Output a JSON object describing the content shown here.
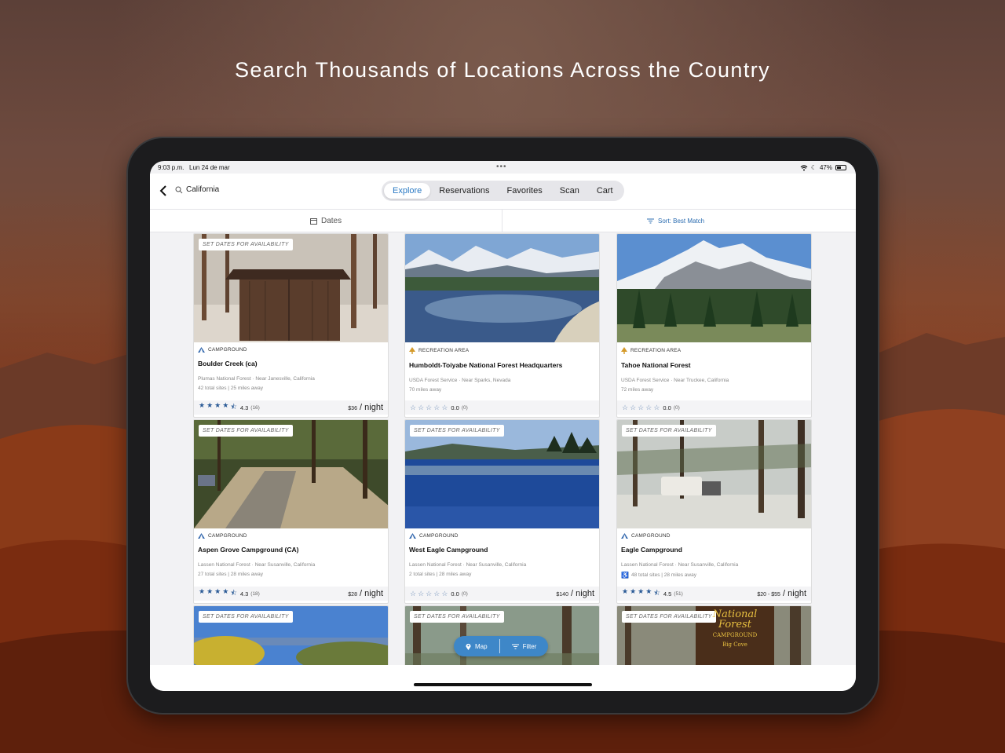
{
  "headline": "Search Thousands of Locations Across the Country",
  "status_bar": {
    "time": "9:03 p.m.",
    "date": "Lun 24 de mar",
    "battery": "47%"
  },
  "search": {
    "value": "California"
  },
  "tabs": [
    {
      "label": "Explore",
      "active": true
    },
    {
      "label": "Reservations",
      "active": false
    },
    {
      "label": "Favorites",
      "active": false
    },
    {
      "label": "Scan",
      "active": false
    },
    {
      "label": "Cart",
      "active": false
    }
  ],
  "filters": {
    "dates_label": "Dates",
    "sort_label": "Sort: Best Match"
  },
  "availability_badge": "SET DATES FOR AVAILABILITY",
  "price_unit": "/ night",
  "cards": [
    {
      "type": "CAMPGROUND",
      "type_icon": "tent-icon",
      "name": "Boulder Creek (ca)",
      "agency": "Plumas National Forest · Near Janesville, California",
      "details": "42 total sites | 25 miles away",
      "rating": 4.3,
      "rating_text": "4.3",
      "reviews": "(16)",
      "price": "$36",
      "show_availability": true
    },
    {
      "type": "RECREATION AREA",
      "type_icon": "tree-icon",
      "name": "Humboldt-Toiyabe National Forest Headquarters",
      "agency": "USDA Forest Service · Near Sparks, Nevada",
      "details": "70 miles away",
      "rating": 0,
      "rating_text": "0.0",
      "reviews": "(0)",
      "price": "",
      "show_availability": false
    },
    {
      "type": "RECREATION AREA",
      "type_icon": "tree-icon",
      "name": "Tahoe National Forest",
      "agency": "USDA Forest Service · Near Truckee, California",
      "details": "72 miles away",
      "rating": 0,
      "rating_text": "0.0",
      "reviews": "(0)",
      "price": "",
      "show_availability": false
    },
    {
      "type": "CAMPGROUND",
      "type_icon": "tent-icon",
      "name": "Aspen Grove Campground (CA)",
      "agency": "Lassen National Forest · Near Susanville, California",
      "details": "27 total sites | 28 miles away",
      "rating": 4.3,
      "rating_text": "4.3",
      "reviews": "(18)",
      "price": "$28",
      "show_availability": true
    },
    {
      "type": "CAMPGROUND",
      "type_icon": "tent-icon",
      "name": "West Eagle Campground",
      "agency": "Lassen National Forest · Near Susanville, California",
      "details": "2 total sites | 28 miles away",
      "rating": 0,
      "rating_text": "0.0",
      "reviews": "(0)",
      "price": "$140",
      "show_availability": true
    },
    {
      "type": "CAMPGROUND",
      "type_icon": "tent-icon",
      "name": "Eagle Campground",
      "agency": "Lassen National Forest · Near Susanville, California",
      "details": "48 total sites | 28 miles away",
      "accessible": true,
      "rating": 4.5,
      "rating_text": "4.5",
      "reviews": "(51)",
      "price": "$20 - $55",
      "show_availability": true
    }
  ],
  "partial_cards": [
    {
      "show_availability": true
    },
    {
      "show_availability": true
    },
    {
      "show_availability": true,
      "sign_text": [
        "National",
        "Forest",
        "CAMPGROUND",
        "Big Cove"
      ]
    }
  ],
  "floating_bar": {
    "map_label": "Map",
    "filter_label": "Filter"
  }
}
